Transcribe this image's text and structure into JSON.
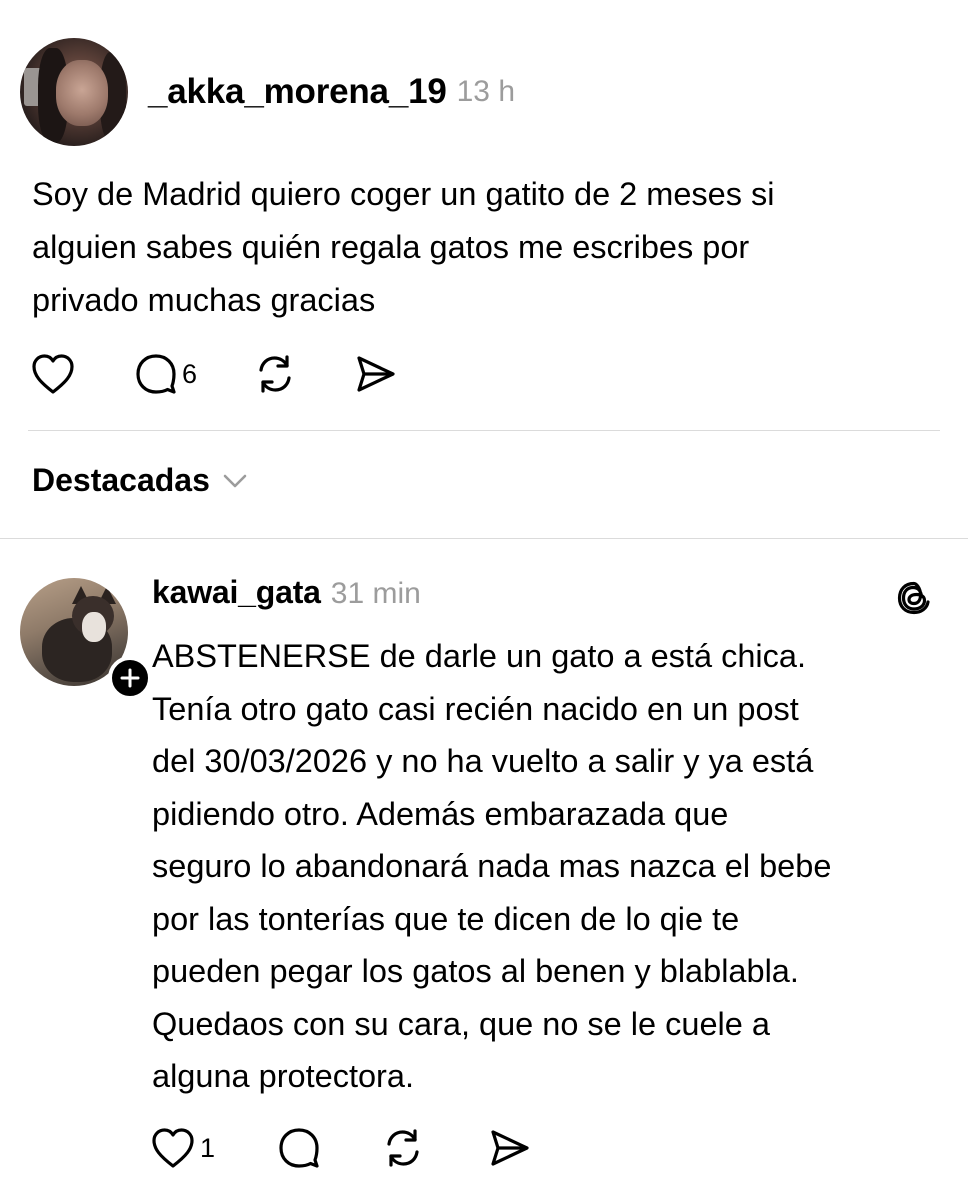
{
  "post": {
    "username": "_akka_morena_19",
    "timestamp": "13 h",
    "text": "Soy de Madrid quiero coger un gatito  de 2 meses si\nalguien  sabes quién regala gatos me escribes  por\nprivado muchas gracias",
    "actions": {
      "like_icon": "heart-icon",
      "comment_icon": "comment-icon",
      "comment_count": "6",
      "repost_icon": "repost-icon",
      "share_icon": "send-icon"
    }
  },
  "sort": {
    "label": "Destacadas",
    "icon": "chevron-down-icon"
  },
  "reply": {
    "username": "kawai_gata",
    "timestamp": "31 min",
    "badge_icon": "threads-icon",
    "text": "ABSTENERSE de darle un gato a está chica.\nTenía otro gato casi recién nacido en un post\ndel 30/03/2026 y no ha vuelto a salir y ya está\npidiendo otro. Además embarazada que\nseguro lo abandonará nada mas nazca el bebe\npor las tonterías que te dicen de lo qie te\npueden pegar los gatos al benen y blablabla.\nQuedaos con su cara, que no se le cuele a\nalguna protectora.",
    "actions": {
      "like_icon": "heart-icon",
      "like_count": "1",
      "comment_icon": "comment-icon",
      "repost_icon": "repost-icon",
      "share_icon": "send-icon"
    }
  },
  "colors": {
    "text": "#000000",
    "muted": "#9c9c9c",
    "divider": "#dbdbdb",
    "background": "#ffffff"
  }
}
